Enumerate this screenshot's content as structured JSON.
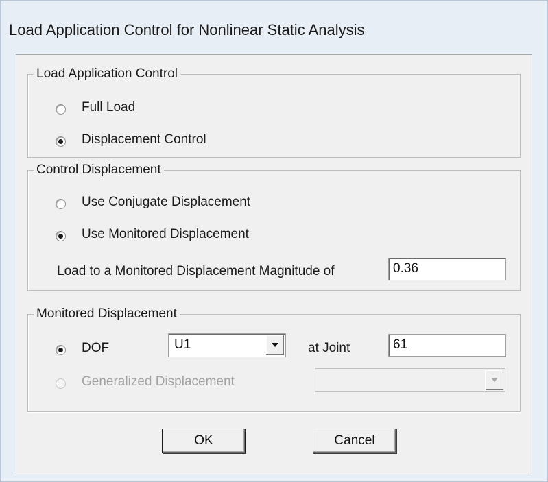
{
  "window": {
    "title": "Load Application Control for Nonlinear Static Analysis"
  },
  "load_application_control": {
    "legend": "Load Application Control",
    "options": [
      {
        "label": "Full Load",
        "selected": false
      },
      {
        "label": "Displacement Control",
        "selected": true
      }
    ]
  },
  "control_displacement": {
    "legend": "Control Displacement",
    "options": [
      {
        "label": "Use Conjugate Displacement",
        "selected": false
      },
      {
        "label": "Use Monitored Displacement",
        "selected": true
      }
    ],
    "magnitude_label": "Load to a Monitored Displacement Magnitude of",
    "magnitude_value": "0.36"
  },
  "monitored_displacement": {
    "legend": "Monitored Displacement",
    "dof_label": "DOF",
    "dof_selected": true,
    "dof_value": "U1",
    "joint_label": "at Joint",
    "joint_value": "61",
    "generalized_label": "Generalized Displacement",
    "generalized_selected": false,
    "generalized_enabled": false,
    "generalized_value": ""
  },
  "buttons": {
    "ok": "OK",
    "cancel": "Cancel"
  },
  "icons": {
    "dropdown": "chevron-down-icon"
  }
}
